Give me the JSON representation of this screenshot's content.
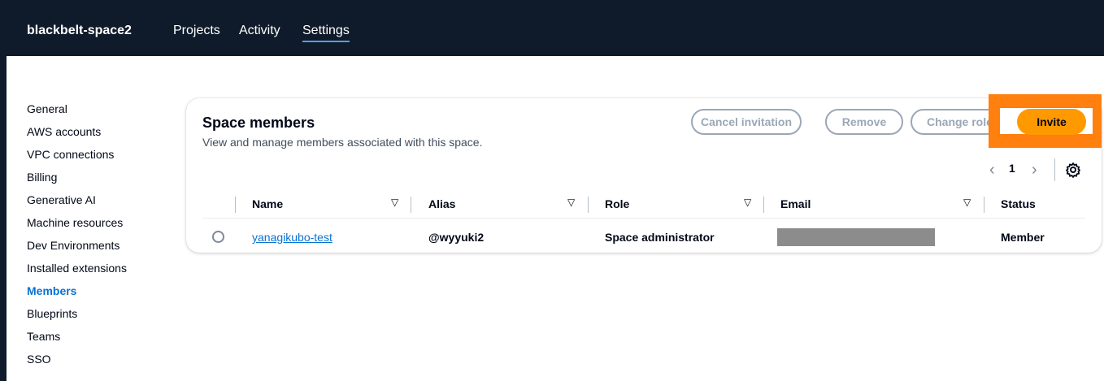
{
  "header": {
    "brand": "blackbelt-space2",
    "nav": [
      {
        "label": "Projects"
      },
      {
        "label": "Activity"
      },
      {
        "label": "Settings",
        "active": true
      }
    ]
  },
  "sidebar": {
    "items": [
      {
        "label": "General"
      },
      {
        "label": "AWS accounts"
      },
      {
        "label": "VPC connections"
      },
      {
        "label": "Billing"
      },
      {
        "label": "Generative AI"
      },
      {
        "label": "Machine resources"
      },
      {
        "label": "Dev Environments"
      },
      {
        "label": "Installed extensions"
      },
      {
        "label": "Members",
        "active": true
      },
      {
        "label": "Blueprints"
      },
      {
        "label": "Teams"
      },
      {
        "label": "SSO"
      }
    ]
  },
  "members": {
    "title": "Space members",
    "description": "View and manage members associated with this space.",
    "buttons": {
      "cancel_invitation": "Cancel invitation",
      "remove": "Remove",
      "change_role": "Change role",
      "invite": "Invite"
    },
    "pagination": {
      "current_page": "1",
      "prev_icon": "chevron-left-icon",
      "next_icon": "chevron-right-icon"
    },
    "settings_icon": "gear-icon",
    "columns": [
      "Name",
      "Alias",
      "Role",
      "Email",
      "Status"
    ],
    "rows": [
      {
        "name": "yanagikubo-test",
        "alias": "@wyyuki2",
        "role": "Space administrator",
        "email": "",
        "status": "Member"
      }
    ]
  },
  "colors": {
    "nav_bg": "#0f1b2a",
    "accent_link": "#0972d3",
    "invite_button": "#ff9900",
    "highlight_box": "#ff7f0f"
  }
}
